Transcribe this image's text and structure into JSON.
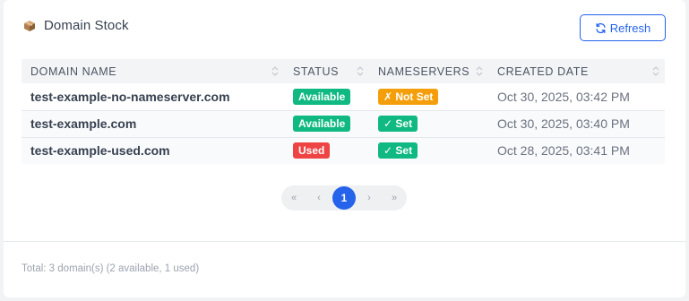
{
  "header": {
    "title": "Domain Stock",
    "title_icon": "package-icon",
    "refresh_label": "Refresh"
  },
  "table": {
    "columns": [
      "DOMAIN NAME",
      "STATUS",
      "NAMESERVERS",
      "CREATED DATE"
    ],
    "rows": [
      {
        "domain": "test-example-no-nameserver.com",
        "status": "Available",
        "status_color": "#10b981",
        "nameservers": "✗ Not Set",
        "ns_color": "#f59e0b",
        "created": "Oct 30, 2025, 03:42 PM"
      },
      {
        "domain": "test-example.com",
        "status": "Available",
        "status_color": "#10b981",
        "nameservers": "✓ Set",
        "ns_color": "#10b981",
        "created": "Oct 30, 2025, 03:40 PM"
      },
      {
        "domain": "test-example-used.com",
        "status": "Used",
        "status_color": "#ef4444",
        "nameservers": "✓ Set",
        "ns_color": "#10b981",
        "created": "Oct 28, 2025, 03:41 PM"
      }
    ]
  },
  "pagination": {
    "first": "«",
    "prev": "‹",
    "current": "1",
    "next": "›",
    "last": "»"
  },
  "footer": {
    "summary": "Total: 3 domain(s) (2 available, 1 used)"
  },
  "colors": {
    "accent": "#2563eb",
    "available": "#10b981",
    "used": "#ef4444",
    "not_set": "#f59e0b"
  }
}
